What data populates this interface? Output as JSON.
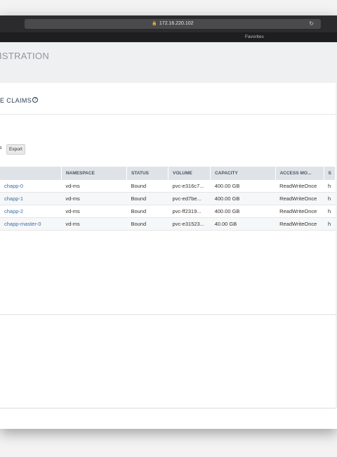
{
  "browser": {
    "url": "172.16.220.102",
    "favorites_label": "Favorites"
  },
  "header": {
    "title": "ISTRATION"
  },
  "page": {
    "title": "E CLAIMS",
    "help_glyph": "?"
  },
  "toolbar": {
    "text": "s",
    "export_label": "Export"
  },
  "table": {
    "columns": [
      "",
      "NAMESPACE",
      "STATUS",
      "VOLUME",
      "CAPACITY",
      "ACCESS MO...",
      "S"
    ],
    "rows": [
      [
        "chapp-0",
        "vd-ms",
        "Bound",
        "pvc-e316c7...",
        "400.00 GB",
        "ReadWriteOnce",
        "h"
      ],
      [
        "chapp-1",
        "vd-ms",
        "Bound",
        "pvc-ed7be...",
        "400.00 GB",
        "ReadWriteOnce",
        "h"
      ],
      [
        "chapp-2",
        "vd-ms",
        "Bound",
        "pvc-ff2319...",
        "400.00 GB",
        "ReadWriteOnce",
        "h"
      ],
      [
        "chapp-master-0",
        "vd-ms",
        "Bound",
        "pvc-e31523...",
        "40.00 GB",
        "ReadWriteOnce",
        "h"
      ]
    ]
  },
  "colors": {
    "link": "#3a6ea5",
    "header_bg": "#dfe3e8",
    "titlebar": "#2b2b2d"
  }
}
